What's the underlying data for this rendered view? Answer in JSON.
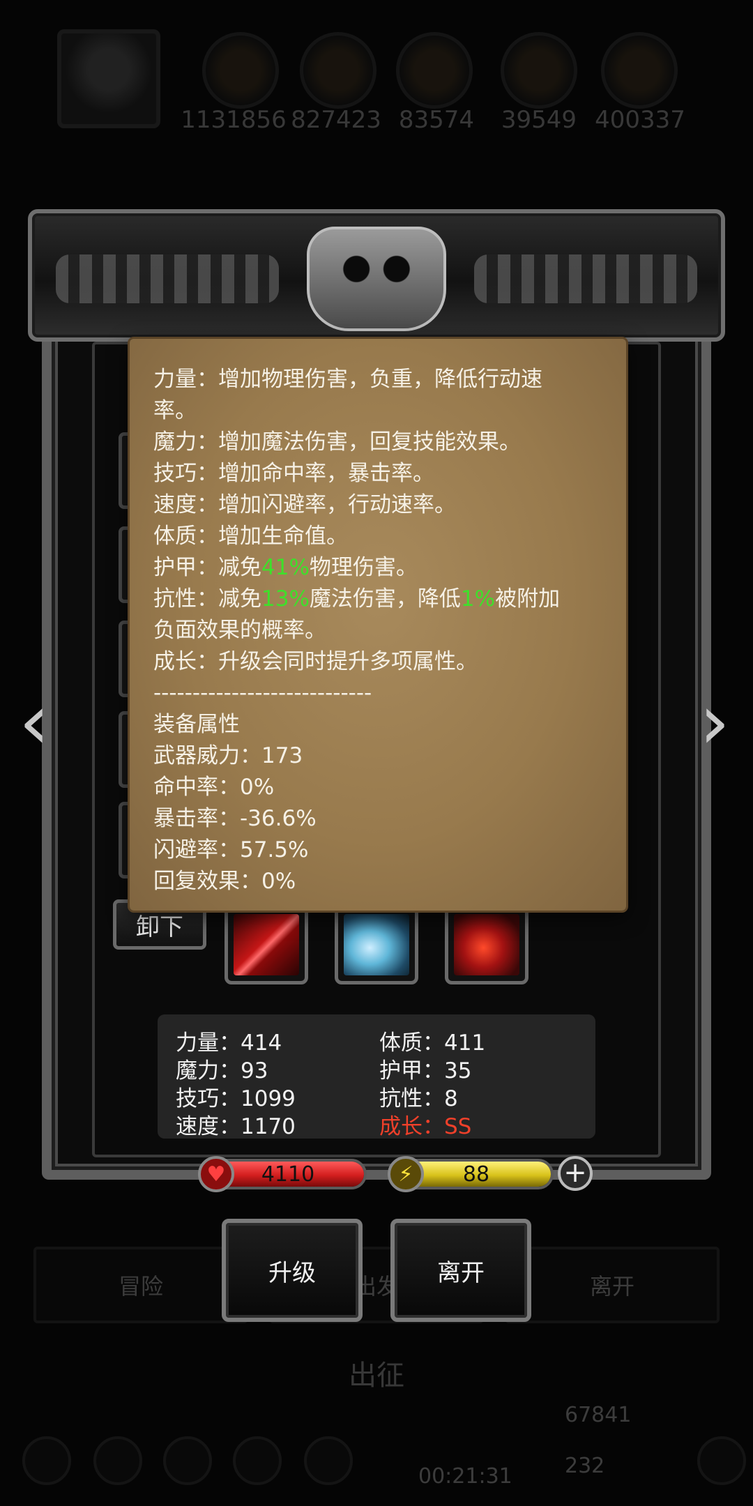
{
  "hud": {
    "resources": [
      "1131856",
      "827423",
      "83574",
      "39549",
      "400337"
    ]
  },
  "background": {
    "tabs": [
      "冒险",
      "出发",
      "离开"
    ],
    "title": "出征",
    "timer": "00:21:31",
    "coin1": "67841",
    "coin2": "232"
  },
  "tooltip": {
    "lines": {
      "strength": "力量：增加物理伤害，负重，降低行动速",
      "strength_cont": "率。",
      "magic": "魔力：增加魔法伤害，回复技能效果。",
      "skill": "技巧：增加命中率，暴击率。",
      "speed": "速度：增加闪避率，行动速率。",
      "constitution": "体质：增加生命值。",
      "armor_prefix": "护甲：减免",
      "armor_value": "41%",
      "armor_suffix": "物理伤害。",
      "resist_prefix": "抗性：减免",
      "resist_value": "13%",
      "resist_mid": "魔法伤害，降低",
      "resist_value2": "1%",
      "resist_suffix": "被附加",
      "resist_cont": "负面效果的概率。",
      "growth": "成长：升级会同时提升多项属性。",
      "divider": "----------------------------",
      "equip_header": "装备属性",
      "weapon_power": "武器威力：173",
      "hit_rate": "命中率：0%",
      "crit_rate": "暴击率：-36.6%",
      "dodge_rate": "闪避率：57.5%",
      "recovery": "回复效果：0%"
    }
  },
  "equipment": {
    "unload_label": "卸下"
  },
  "stats": {
    "strength": "力量：414",
    "magic": "魔力：93",
    "skill": "技巧：1099",
    "speed": "速度：1170",
    "constitution": "体质：411",
    "armor": "护甲：35",
    "resist": "抗性：8",
    "growth": "成长：SS"
  },
  "bars": {
    "hp": "4110",
    "hp_fill": 1.0,
    "mp": "88",
    "mp_fill": 1.0,
    "hp_color": "#d31e1e",
    "mp_color": "#d8c21a"
  },
  "actions": {
    "upgrade": "升级",
    "leave": "离开"
  },
  "icons": [
    "heart-icon",
    "lightning-icon",
    "plus-icon",
    "chevron-left-icon",
    "chevron-right-icon"
  ]
}
